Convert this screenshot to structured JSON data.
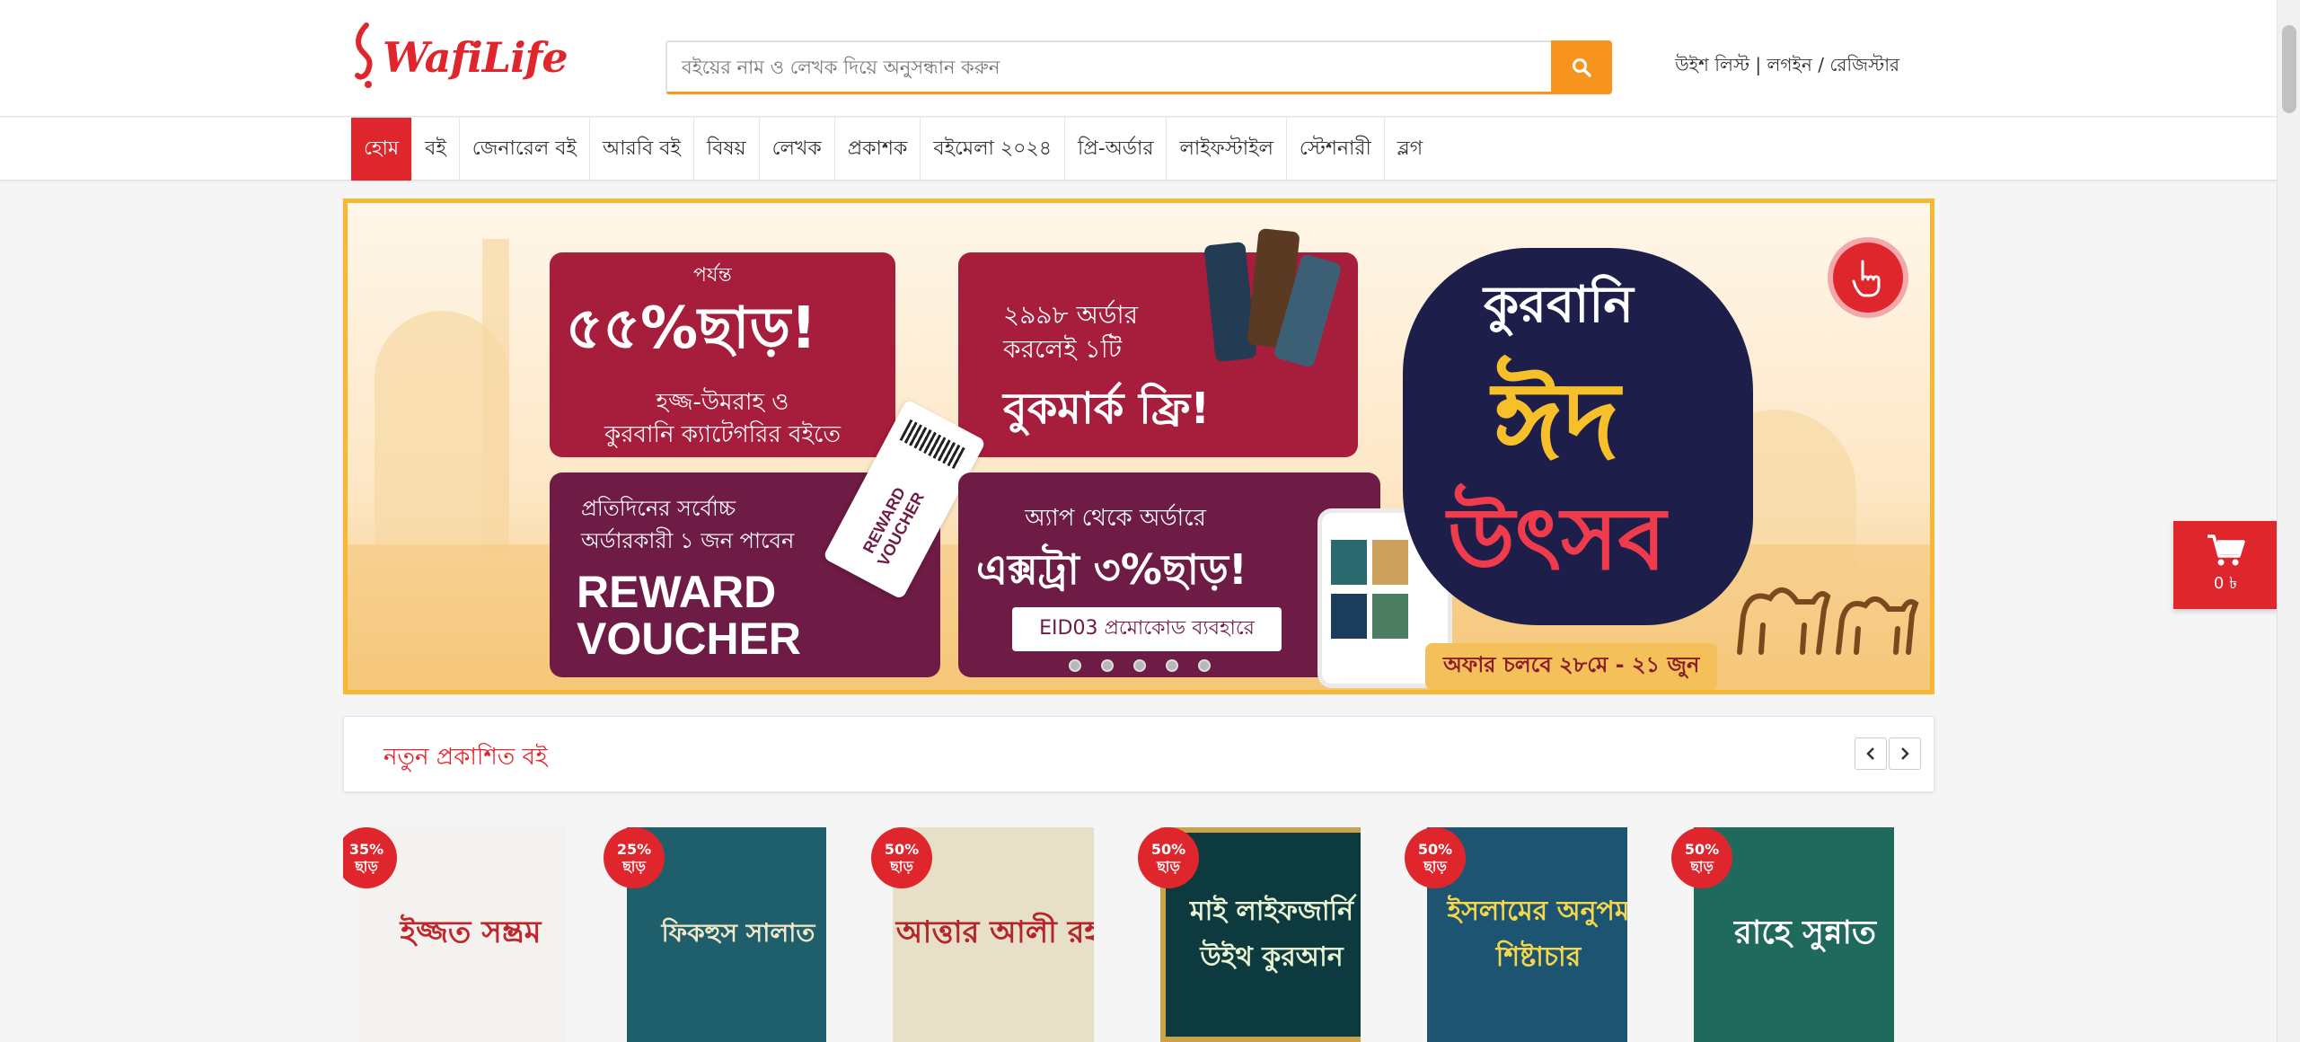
{
  "header": {
    "logo_text": "WafiLife",
    "search_placeholder": "বইয়ের নাম ও লেখক দিয়ে অনুসন্ধান করুন",
    "wishlist": "উইশ লিস্ট",
    "login": "লগইন",
    "register": "রেজিস্টার"
  },
  "nav": {
    "items": [
      "হোম",
      "বই",
      "জেনারেল বই",
      "আরবি বই",
      "বিষয়",
      "লেখক",
      "প্রকাশক",
      "বইমেলা ২০২৪",
      "প্রি-অর্ডার",
      "লাইফস্টাইল",
      "স্টেশনারী",
      "ব্লগ"
    ]
  },
  "banner": {
    "card1_top": "পর্যন্ত",
    "card1_big": "৫৫%ছাড়!",
    "card1_sub1": "হজ্জ-উমরাহ ও",
    "card1_sub2": "কুরবানি ক্যাটেগরির বইতে",
    "card2_line1": "২৯৯৮ অর্ডার",
    "card2_line2": "করলেই ১টি",
    "card2_big": "বুকমার্ক ফ্রি!",
    "card3_line1": "প্রতিদিনের সর্বোচ্চ",
    "card3_line2": "অর্ডারকারী ১ জন পাবেন",
    "card3_big1": "REWARD",
    "card3_big2": "VOUCHER",
    "ticket_text": "REWARD VOUCHER",
    "card4_line1": "অ্যাপ থেকে অর্ডারে",
    "card4_big": "এক্সট্রা ৩%ছাড়!",
    "card4_code": "EID03 প্রমোকোড ব্যবহারে",
    "title_top": "কুরবানি",
    "title_mid": "ঈদ",
    "title_bottom": "উৎসব",
    "offer_text": "অফার চলবে ২৮মে - ২১ জুন",
    "slides": 5
  },
  "section": {
    "title": "নতুন প্রকাশিত বই"
  },
  "books": [
    {
      "discount": "35%",
      "off_label": "ছাড়",
      "title": "ইজ্জত সম্ভ্রম",
      "bg": "#f4f2ee",
      "fg": "#c0272d"
    },
    {
      "discount": "25%",
      "off_label": "ছাড়",
      "title": "ফিকহুস সালাত",
      "bg": "#1e5f6b",
      "fg": "#f2e7c8"
    },
    {
      "discount": "50%",
      "off_label": "ছাড়",
      "title": "আত্তার আলী রহ.",
      "bg": "#e8dfc9",
      "fg": "#b3262b"
    },
    {
      "discount": "50%",
      "off_label": "ছাড়",
      "title": "মাই লাইফজার্নি উইথ কুরআন",
      "bg": "#0d3a3f",
      "fg": "#e9f3d2"
    },
    {
      "discount": "50%",
      "off_label": "ছাড়",
      "title": "ইসলামের অনুপম শিষ্টাচার",
      "bg": "#1d5471",
      "fg": "#f6d64a"
    },
    {
      "discount": "50%",
      "off_label": "ছাড়",
      "title": "রাহে সুন্নাত",
      "bg": "#1f6a5c",
      "fg": "#ffffff"
    }
  ],
  "cart": {
    "total": "0 ৳"
  },
  "colors": {
    "brand_red": "#e0262d",
    "search_orange": "#f7941d"
  }
}
